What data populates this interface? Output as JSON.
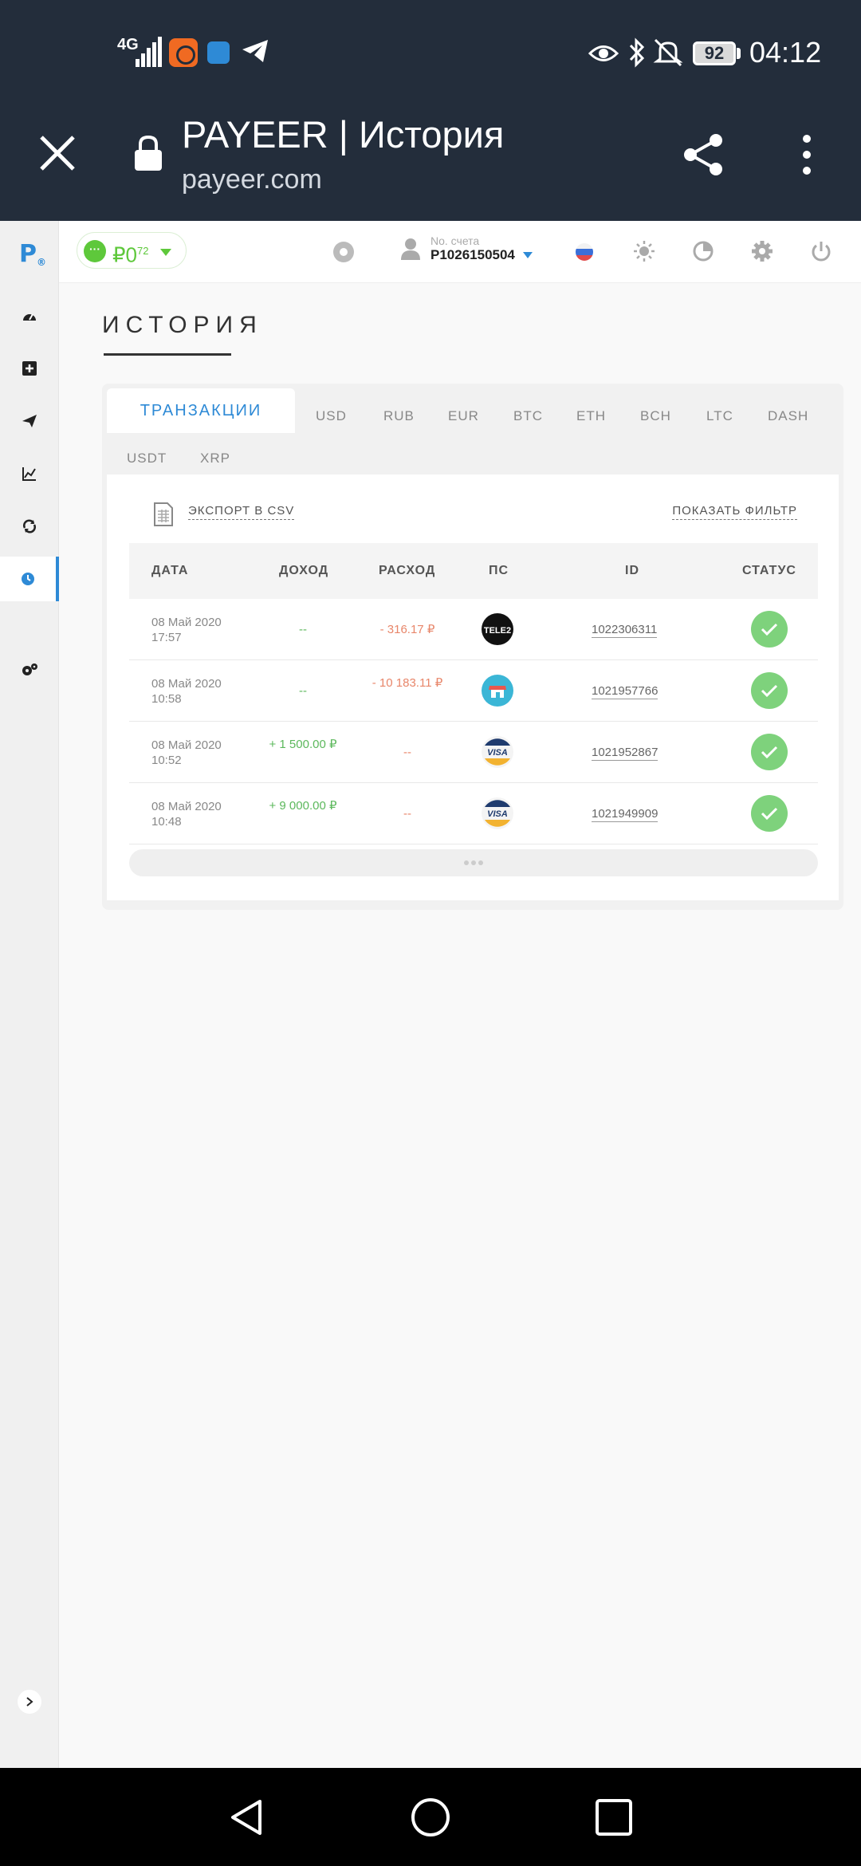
{
  "status_bar": {
    "network": "4G",
    "battery": "92",
    "time": "04:12"
  },
  "browser": {
    "title": "PAYEER | История",
    "url": "payeer.com"
  },
  "app": {
    "logo": "P",
    "balance_main": "₽0",
    "balance_cents": "72",
    "account_label": "No. счета",
    "account_number": "P1026150504"
  },
  "page": {
    "title": "ИСТОРИЯ"
  },
  "tabs": [
    "ТРАНЗАКЦИИ",
    "USD",
    "RUB",
    "EUR",
    "BTC",
    "ETH",
    "BCH",
    "LTC",
    "DASH",
    "USDT",
    "XRP"
  ],
  "actions": {
    "export": "ЭКСПОРТ В CSV",
    "filter": "ПОКАЗАТЬ ФИЛЬТР"
  },
  "table": {
    "headers": [
      "ДАТА",
      "ДОХОД",
      "РАСХОД",
      "ПС",
      "ID",
      "СТАТУС"
    ],
    "rows": [
      {
        "date": "08 Май 2020",
        "time": "17:57",
        "income": "--",
        "expense": "- 316.17 ₽",
        "ps": "TELE2",
        "ps_icon": "tele2-icon",
        "id": "1022306311",
        "status": "success"
      },
      {
        "date": "08 Май 2020",
        "time": "10:58",
        "income": "--",
        "expense": "- 10 183.11 ₽",
        "ps": "shop",
        "ps_icon": "shop-icon",
        "id": "1021957766",
        "status": "success"
      },
      {
        "date": "08 Май 2020",
        "time": "10:52",
        "income": "+ 1 500.00 ₽",
        "expense": "--",
        "ps": "VISA",
        "ps_icon": "visa-icon",
        "id": "1021952867",
        "status": "success"
      },
      {
        "date": "08 Май 2020",
        "time": "10:48",
        "income": "+ 9 000.00 ₽",
        "expense": "--",
        "ps": "VISA",
        "ps_icon": "visa-icon",
        "id": "1021949909",
        "status": "success"
      }
    ]
  },
  "colors": {
    "header_bg": "#232d3b",
    "accent": "#2e8ad6",
    "income": "#5cb85c",
    "expense": "#e8866a",
    "status_ok": "#7ed27c"
  }
}
